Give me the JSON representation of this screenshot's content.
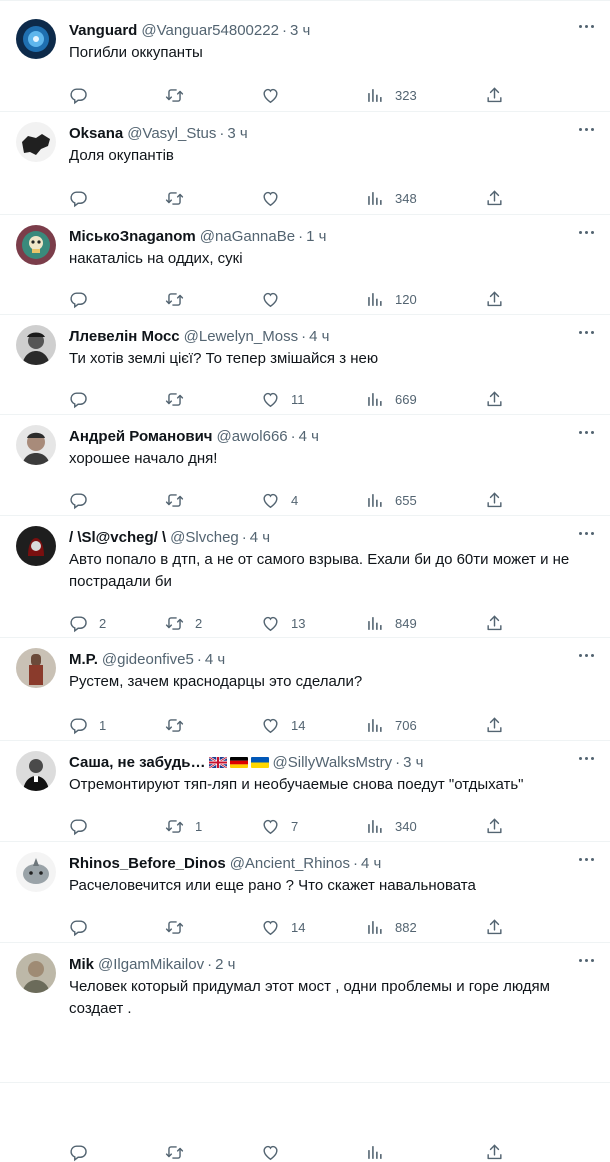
{
  "tweets": [
    {
      "name": "Vanguard",
      "handle": "@Vanguar54800222",
      "time": "3 ч",
      "text": "Погибли оккупанты",
      "replies": "",
      "retweets": "",
      "likes": "",
      "views": "323",
      "avatar": "vanguard"
    },
    {
      "name": "Oksana",
      "handle": "@Vasyl_Stus",
      "time": "3 ч",
      "text": "Доля окупантів",
      "replies": "",
      "retweets": "",
      "likes": "",
      "views": "348",
      "avatar": "oksana"
    },
    {
      "name": "МіськоЗnаganom",
      "handle": "@naGannaBe",
      "time": "1 ч",
      "text": "накаталісь на оддих, сукі",
      "replies": "",
      "retweets": "",
      "likes": "",
      "views": "120",
      "avatar": "misko"
    },
    {
      "name": "Ллевелін Мосс",
      "handle": "@Lewelyn_Moss",
      "time": "4 ч",
      "text": "Ти хотів землі цієї? То тепер змішайся з нею",
      "replies": "",
      "retweets": "",
      "likes": "11",
      "views": "669",
      "avatar": "llevelin"
    },
    {
      "name": "Андрей Романович",
      "handle": "@awol666",
      "time": "4 ч",
      "text": "хорошее начало дня!",
      "replies": "",
      "retweets": "",
      "likes": "4",
      "views": "655",
      "avatar": "andrey"
    },
    {
      "name": "/ \\Sl@vcheg/ \\",
      "handle": "@Slvcheg",
      "time": "4 ч",
      "text": "Авто попало в дтп, а не от самого взрыва. Ехали би до 60ти может и не пострадали би",
      "replies": "2",
      "retweets": "2",
      "likes": "13",
      "views": "849",
      "avatar": "slavcheg"
    },
    {
      "name": "M.P.",
      "handle": "@gideonfive5",
      "time": "4 ч",
      "text": "Рустем, зачем краснодарцы это сделали?",
      "replies": "1",
      "retweets": "",
      "likes": "14",
      "views": "706",
      "avatar": "mp"
    },
    {
      "name": "Саша, не забудь…",
      "handle": "@SillyWalksMstry",
      "time": "3 ч",
      "text": "Отремонтируют тяп-ляп и необучаемые снова поедут \"отдыхать\"",
      "replies": "",
      "retweets": "1",
      "likes": "7",
      "views": "340",
      "avatar": "sasha",
      "flags": [
        "gb",
        "de",
        "ua"
      ]
    },
    {
      "name": "Rhinos_Before_Dinos",
      "handle": "@Ancient_Rhinos",
      "time": "4 ч",
      "text": "Расчеловечится  или еще рано ? Что скажет навальновата",
      "replies": "",
      "retweets": "",
      "likes": "14",
      "views": "882",
      "avatar": "rhinos"
    },
    {
      "name": "Mik",
      "handle": "@IlgamMikailov",
      "time": "2 ч",
      "text": "Человек который придумал этот мост , одни проблемы и горе людям создает .",
      "replies": "",
      "retweets": "",
      "likes": "",
      "views": "",
      "avatar": "mik"
    }
  ],
  "colors": {
    "secondary_text": "#536471",
    "primary_text": "#0f1419",
    "divider": "#eff3f4"
  },
  "icons": {
    "reply": "reply-icon",
    "retweet": "retweet-icon",
    "like": "heart-icon",
    "views": "views-icon",
    "share": "share-icon",
    "more": "more-icon"
  }
}
